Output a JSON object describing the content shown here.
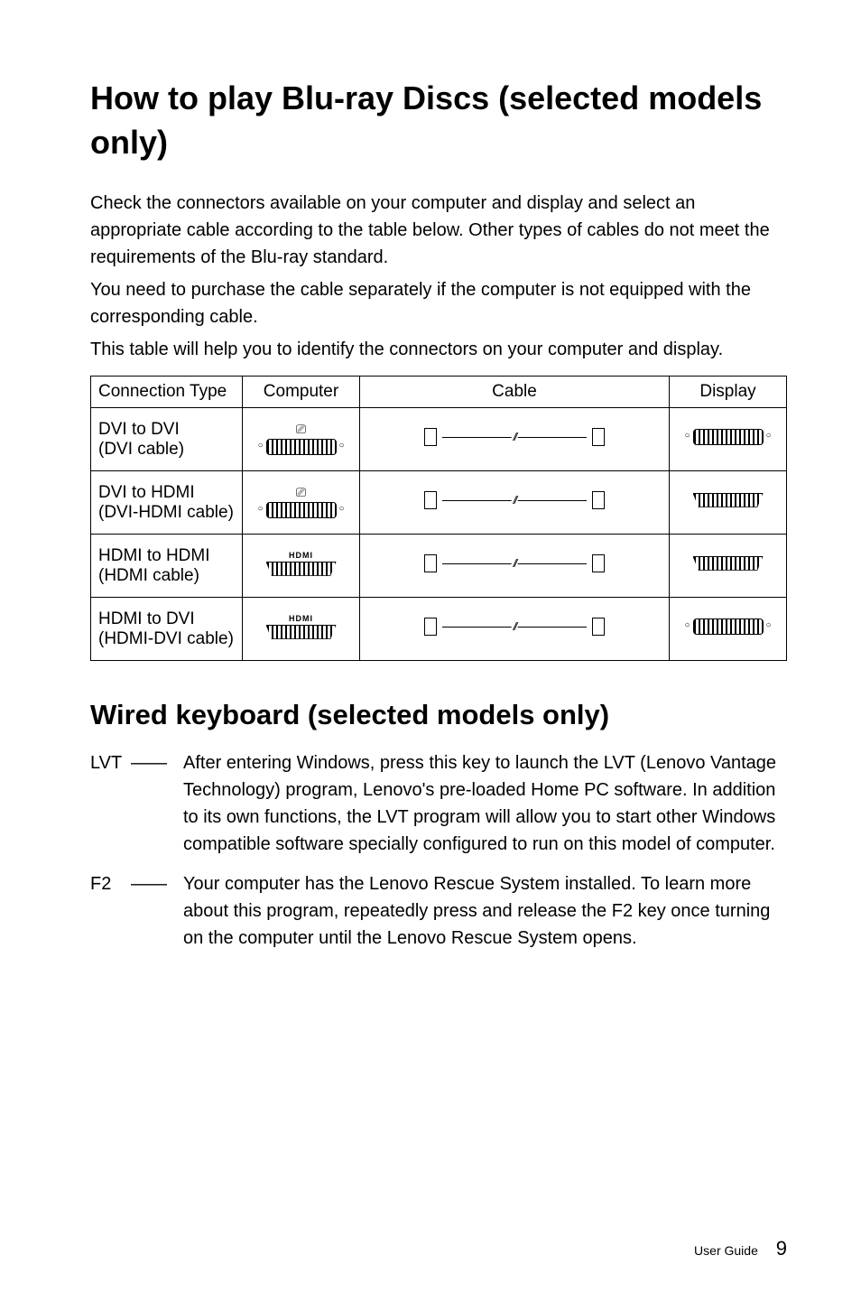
{
  "heading1": "How to play Blu-ray Discs (selected models only)",
  "intro1": "Check the connectors available on your computer and display and select an appropriate cable according to the table below. Other types of cables do not meet the requirements of the Blu-ray standard.",
  "intro2": "You need to purchase the cable separately if the computer is not equipped with the corresponding cable.",
  "intro3": "This table will help you to identify the connectors on your computer and display.",
  "table": {
    "headers": [
      "Connection Type",
      "Computer",
      "Cable",
      "Display"
    ],
    "rows": [
      {
        "type": "DVI to DVI\n(DVI cable)",
        "computer_icon": "dvi-with-symbol",
        "cable_icon": "cable-dvi-dvi",
        "display_icon": "dvi-port"
      },
      {
        "type": "DVI to HDMI\n(DVI-HDMI cable)",
        "computer_icon": "dvi-with-symbol",
        "cable_icon": "cable-dvi-hdmi",
        "display_icon": "hdmi-port"
      },
      {
        "type": "HDMI to HDMI\n(HDMI cable)",
        "computer_icon": "hdmi-with-label",
        "cable_icon": "cable-hdmi-hdmi",
        "display_icon": "hdmi-port"
      },
      {
        "type": "HDMI to DVI\n(HDMI-DVI cable)",
        "computer_icon": "hdmi-with-label",
        "cable_icon": "cable-hdmi-dvi",
        "display_icon": "dvi-port"
      }
    ],
    "hdmi_label": "HDMI"
  },
  "heading2": "Wired keyboard (selected models only)",
  "definitions": [
    {
      "key": "LVT",
      "dash": "——",
      "text": "After entering Windows, press this key to launch the LVT (Lenovo Vantage Technology) program, Lenovo's pre-loaded Home PC software. In addition to its own functions, the LVT program will allow you to start other Windows compatible software specially configured to run on this model of computer."
    },
    {
      "key": "F2",
      "dash": "——",
      "text": "Your computer has the Lenovo Rescue System installed. To learn more about this program, repeatedly press and release the F2 key once turning on the computer until the Lenovo Rescue System opens."
    }
  ],
  "footer_label": "User Guide",
  "footer_page": "9"
}
